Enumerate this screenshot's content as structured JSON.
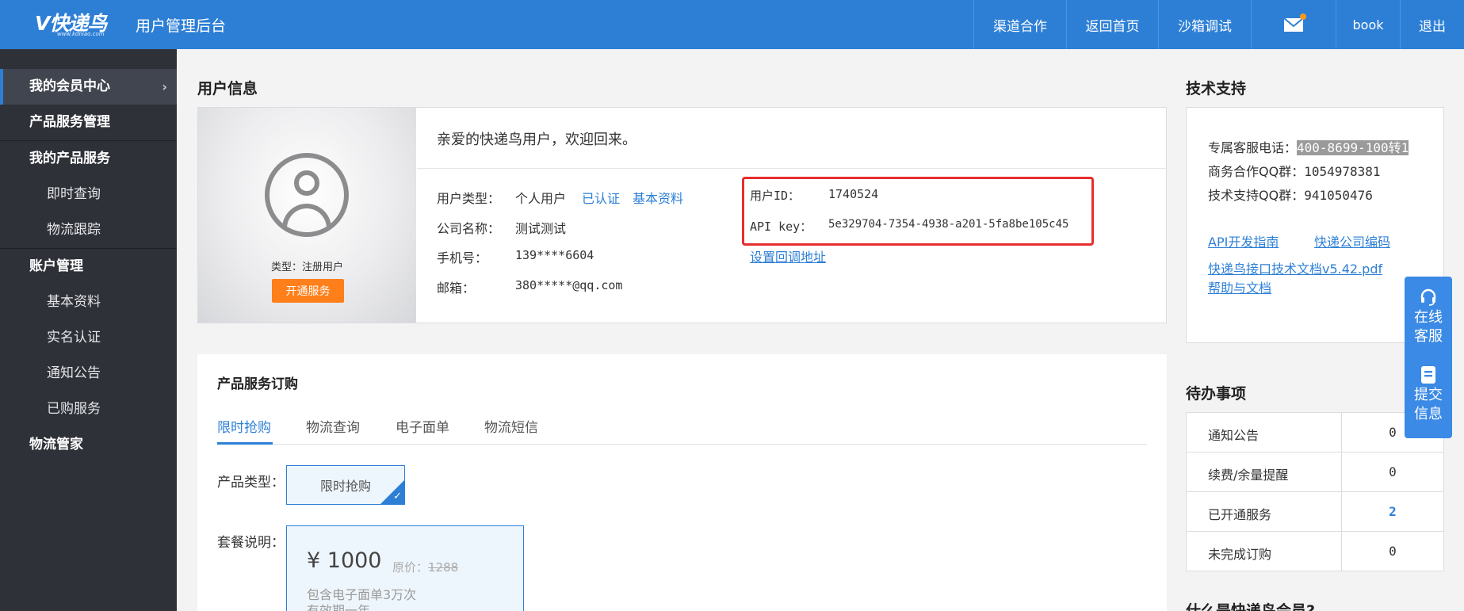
{
  "header": {
    "logo_text": "快递鸟",
    "logo_url": "www.kdniao.com",
    "app_title": "用户管理后台",
    "nav": [
      "渠道合作",
      "返回首页",
      "沙箱调试",
      "book",
      "退出"
    ]
  },
  "sidebar": {
    "items": [
      {
        "label": "我的会员中心",
        "chevron": "›"
      },
      {
        "label": "产品服务管理"
      },
      {
        "label": "我的产品服务"
      },
      {
        "label": "即时查询"
      },
      {
        "label": "物流跟踪"
      },
      {
        "label": "账户管理"
      },
      {
        "label": "基本资料"
      },
      {
        "label": "实名认证"
      },
      {
        "label": "通知公告"
      },
      {
        "label": "已购服务"
      },
      {
        "label": "物流管家"
      }
    ]
  },
  "user_info": {
    "section_title": "用户信息",
    "avatar_type": "类型：注册用户",
    "open_service_button": "开通服务",
    "welcome": "亲爱的快递鸟用户，欢迎回来。",
    "user_type_label": "用户类型：",
    "user_type_value": "个人用户",
    "verified_link": "已认证",
    "basic_info_link": "基本资料",
    "company_label": "公司名称：",
    "company_value": "测试测试",
    "phone_label": "手机号：",
    "phone_value": "139****6604",
    "email_label": "邮箱：",
    "email_value": "380*****@qq.com",
    "user_id_label": "用户ID：",
    "user_id_value": "1740524",
    "api_key_label": "API key：",
    "api_key_value": "5e329704-7354-4938-a201-5fa8be105c45",
    "callback_link": "设置回调地址"
  },
  "order": {
    "title": "产品服务订购",
    "tabs": [
      "限时抢购",
      "物流查询",
      "电子面单",
      "物流短信"
    ],
    "product_type_label": "产品类型：",
    "product_type_option": "限时抢购",
    "package_label": "套餐说明：",
    "price": "¥ 1000",
    "orig_price_label": "原价：",
    "orig_price_value": "1288",
    "desc_line1": "包含电子面单3万次",
    "desc_line2": "有效期一年"
  },
  "support": {
    "section_title": "技术支持",
    "hotline_label": "专属客服电话：",
    "hotline_value": "400-8699-100转1",
    "biz_qq_label": "商务合作QQ群：",
    "biz_qq_value": "1054978381",
    "tech_qq_label": "技术支持QQ群：",
    "tech_qq_value": "941050476",
    "link_api_guide": "API开发指南",
    "link_courier_code": "快递公司编码",
    "link_api_doc": "快递鸟接口技术文档v5.42.pdf",
    "link_help": "帮助与文档"
  },
  "todo": {
    "section_title": "待办事项",
    "rows": [
      {
        "name": "通知公告",
        "value": "0"
      },
      {
        "name": "续费/余量提醒",
        "value": "0"
      },
      {
        "name": "已开通服务",
        "value": "2"
      },
      {
        "name": "未完成订购",
        "value": "0"
      }
    ]
  },
  "float_widget": {
    "online_service": "在线客服",
    "submit_info": "提交信息"
  },
  "bottom": {
    "member_title": "什么是快递鸟会员?"
  },
  "colors": {
    "brand_blue": "#2d7fd6",
    "orange": "#ff7f1a",
    "sidebar_bg": "#2f3138",
    "highlight_red": "#e62e2e"
  },
  "icons": [
    "mail-icon",
    "avatar-icon",
    "headset-icon",
    "form-icon",
    "chevron-right-icon",
    "check-icon"
  ]
}
